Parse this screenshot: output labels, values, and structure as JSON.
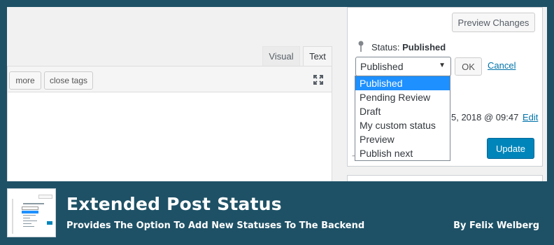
{
  "editor": {
    "tabs": [
      {
        "label": "Visual"
      },
      {
        "label": "Text"
      }
    ],
    "quicktags": [
      {
        "label": "more"
      },
      {
        "label": "close tags"
      }
    ]
  },
  "publish": {
    "preview_button": "Preview Changes",
    "status_label": "Status:",
    "status_value": "Published",
    "select_value": "Published",
    "ok_button": "OK",
    "cancel_link": "Cancel",
    "options": [
      "Published",
      "Pending Review",
      "Draft",
      "My custom status",
      "Preview",
      "Publish next"
    ],
    "selected_option": "Published",
    "date_text": "5, 2018 @ 09:47",
    "edit_link": "Edit",
    "partial_link": "t",
    "partial_mark": "→",
    "update_button": "Update"
  },
  "caption": {
    "title": "Extended Post Status",
    "subtitle": "Provides The Option To Add New Statuses To The Backend",
    "author": "By Felix Welberg"
  },
  "colors": {
    "banner": "#1e5166",
    "accent": "#0085ba",
    "selection": "#1e90ff",
    "link": "#0073aa"
  }
}
